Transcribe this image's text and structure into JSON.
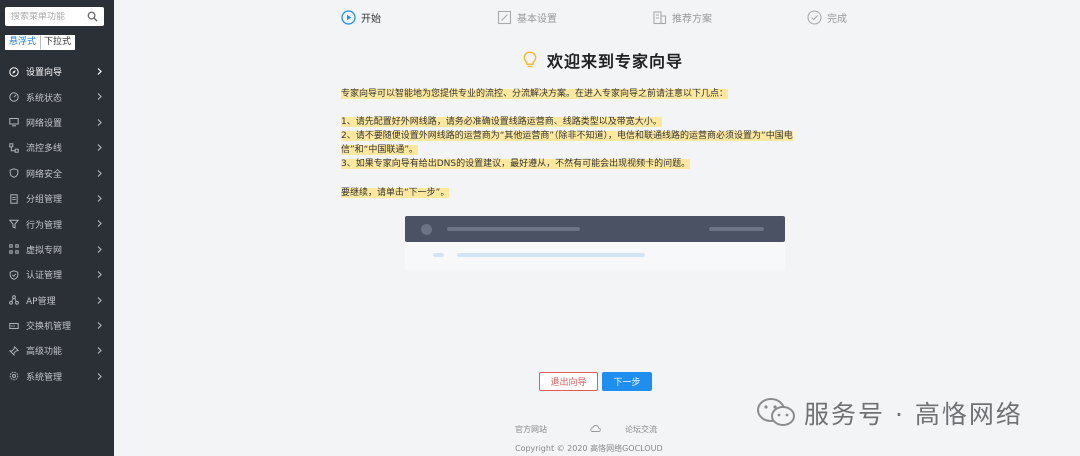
{
  "sidebar": {
    "search_placeholder": "搜索菜单功能",
    "mode_floating": "悬浮式",
    "mode_dropdown": "下拉式",
    "items": [
      {
        "label": "设置向导",
        "icon": "compass-icon",
        "active": true
      },
      {
        "label": "系统状态",
        "icon": "dashboard-icon",
        "active": false
      },
      {
        "label": "网络设置",
        "icon": "monitor-icon",
        "active": false
      },
      {
        "label": "流控多线",
        "icon": "network-icon",
        "active": false
      },
      {
        "label": "网络安全",
        "icon": "shield-icon",
        "active": false
      },
      {
        "label": "分组管理",
        "icon": "document-icon",
        "active": false
      },
      {
        "label": "行为管理",
        "icon": "filter-icon",
        "active": false
      },
      {
        "label": "虚拟专网",
        "icon": "vpn-icon",
        "active": false
      },
      {
        "label": "认证管理",
        "icon": "shield-check-icon",
        "active": false
      },
      {
        "label": "AP管理",
        "icon": "ap-icon",
        "active": false
      },
      {
        "label": "交换机管理",
        "icon": "switch-icon",
        "active": false
      },
      {
        "label": "高级功能",
        "icon": "pin-icon",
        "active": false
      },
      {
        "label": "系统管理",
        "icon": "gear-icon",
        "active": false
      }
    ]
  },
  "steps": [
    {
      "label": "开始",
      "icon": "play-circle-icon",
      "active": true
    },
    {
      "label": "基本设置",
      "icon": "settings-icon",
      "active": false
    },
    {
      "label": "推荐方案",
      "icon": "building-icon",
      "active": false
    },
    {
      "label": "完成",
      "icon": "check-circle-icon",
      "active": false
    }
  ],
  "main": {
    "title": "欢迎来到专家向导",
    "intro": "专家向导可以智能地为您提供专业的流控、分流解决方案。在进入专家向导之前请注意以下几点：",
    "point1": "1、请先配置好外网线路，请务必准确设置线路运营商、线路类型以及带宽大小。",
    "point2_line1": "2、请不要随便设置外网线路的运营商为“其他运营商”（除非不知道），电信和联通线路的运营商必须设置为“中国电",
    "point2_line2": "信”和“中国联通”。",
    "point3": "3、如果专家向导有给出DNS的设置建议，最好遵从，不然有可能会出现视频卡的问题。",
    "continue": "要继续，请单击“下一步”。"
  },
  "buttons": {
    "exit": "退出向导",
    "next": "下一步"
  },
  "footer": {
    "link_official": "官方网站",
    "link_forum": "论坛交流",
    "copyright": "Copyright © 2020 高恪网络GOCLOUD"
  },
  "watermark": {
    "text": "服务号 · 高恪网络"
  },
  "colors": {
    "accent": "#1e8ef0",
    "danger": "#e05a5a",
    "highlight": "#fde8a0",
    "sidebar": "#2b2f36"
  }
}
